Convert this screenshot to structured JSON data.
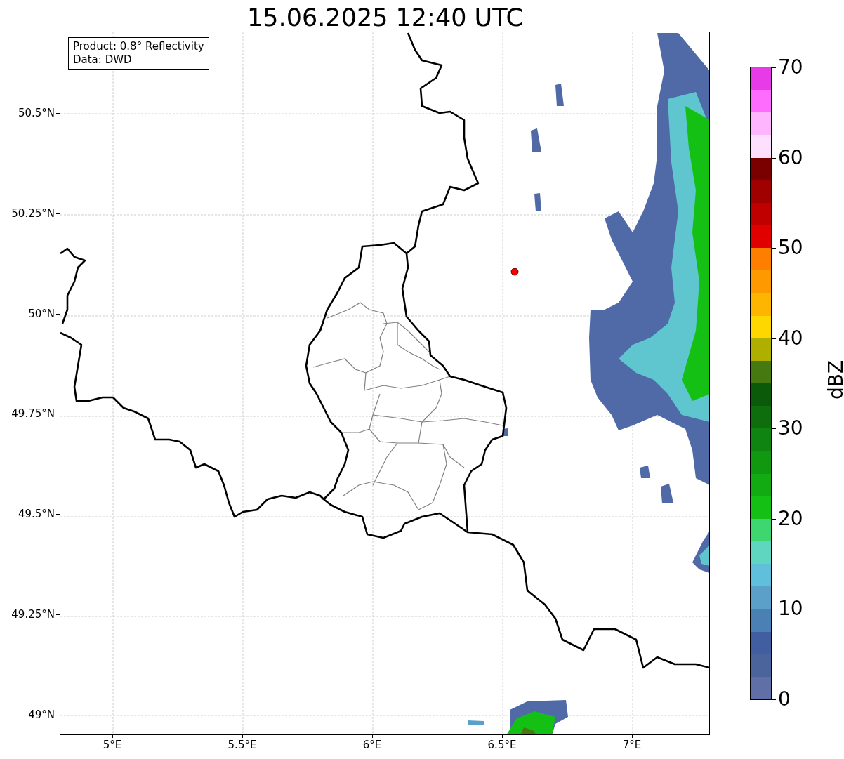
{
  "title": "15.06.2025 12:40 UTC",
  "info_box": [
    "Product: 0.8° Reflectivity",
    "Data: DWD"
  ],
  "map": {
    "lon_ticks": [
      "5°E",
      "5.5°E",
      "6°E",
      "6.5°E",
      "7°E"
    ],
    "lat_ticks": [
      "50.5°N",
      "50.25°N",
      "50°N",
      "49.75°N",
      "49.5°N",
      "49.25°N",
      "49°N"
    ]
  },
  "colorbar": {
    "label": "dBZ",
    "ticks": [
      "70",
      "60",
      "50",
      "40",
      "30",
      "20",
      "10",
      "0"
    ],
    "segments": [
      {
        "color": "#e83be8"
      },
      {
        "color": "#fd6cfd"
      },
      {
        "color": "#feb5fe"
      },
      {
        "color": "#fee0fe"
      },
      {
        "color": "#7a0000"
      },
      {
        "color": "#a00000"
      },
      {
        "color": "#c00000"
      },
      {
        "color": "#e00000"
      },
      {
        "color": "#fe7f00"
      },
      {
        "color": "#fe9a00"
      },
      {
        "color": "#feb500"
      },
      {
        "color": "#fed700"
      },
      {
        "color": "#afaf00"
      },
      {
        "color": "#467a10"
      },
      {
        "color": "#0a5a0a"
      },
      {
        "color": "#0e6e0e"
      },
      {
        "color": "#108410"
      },
      {
        "color": "#109810"
      },
      {
        "color": "#12ac12"
      },
      {
        "color": "#14c014"
      },
      {
        "color": "#3ed66e"
      },
      {
        "color": "#5ed6c0"
      },
      {
        "color": "#60c0dc"
      },
      {
        "color": "#5aa0c8"
      },
      {
        "color": "#4a80b4"
      },
      {
        "color": "#405ea0"
      },
      {
        "color": "#4c649c"
      },
      {
        "color": "#6070a6"
      }
    ]
  }
}
